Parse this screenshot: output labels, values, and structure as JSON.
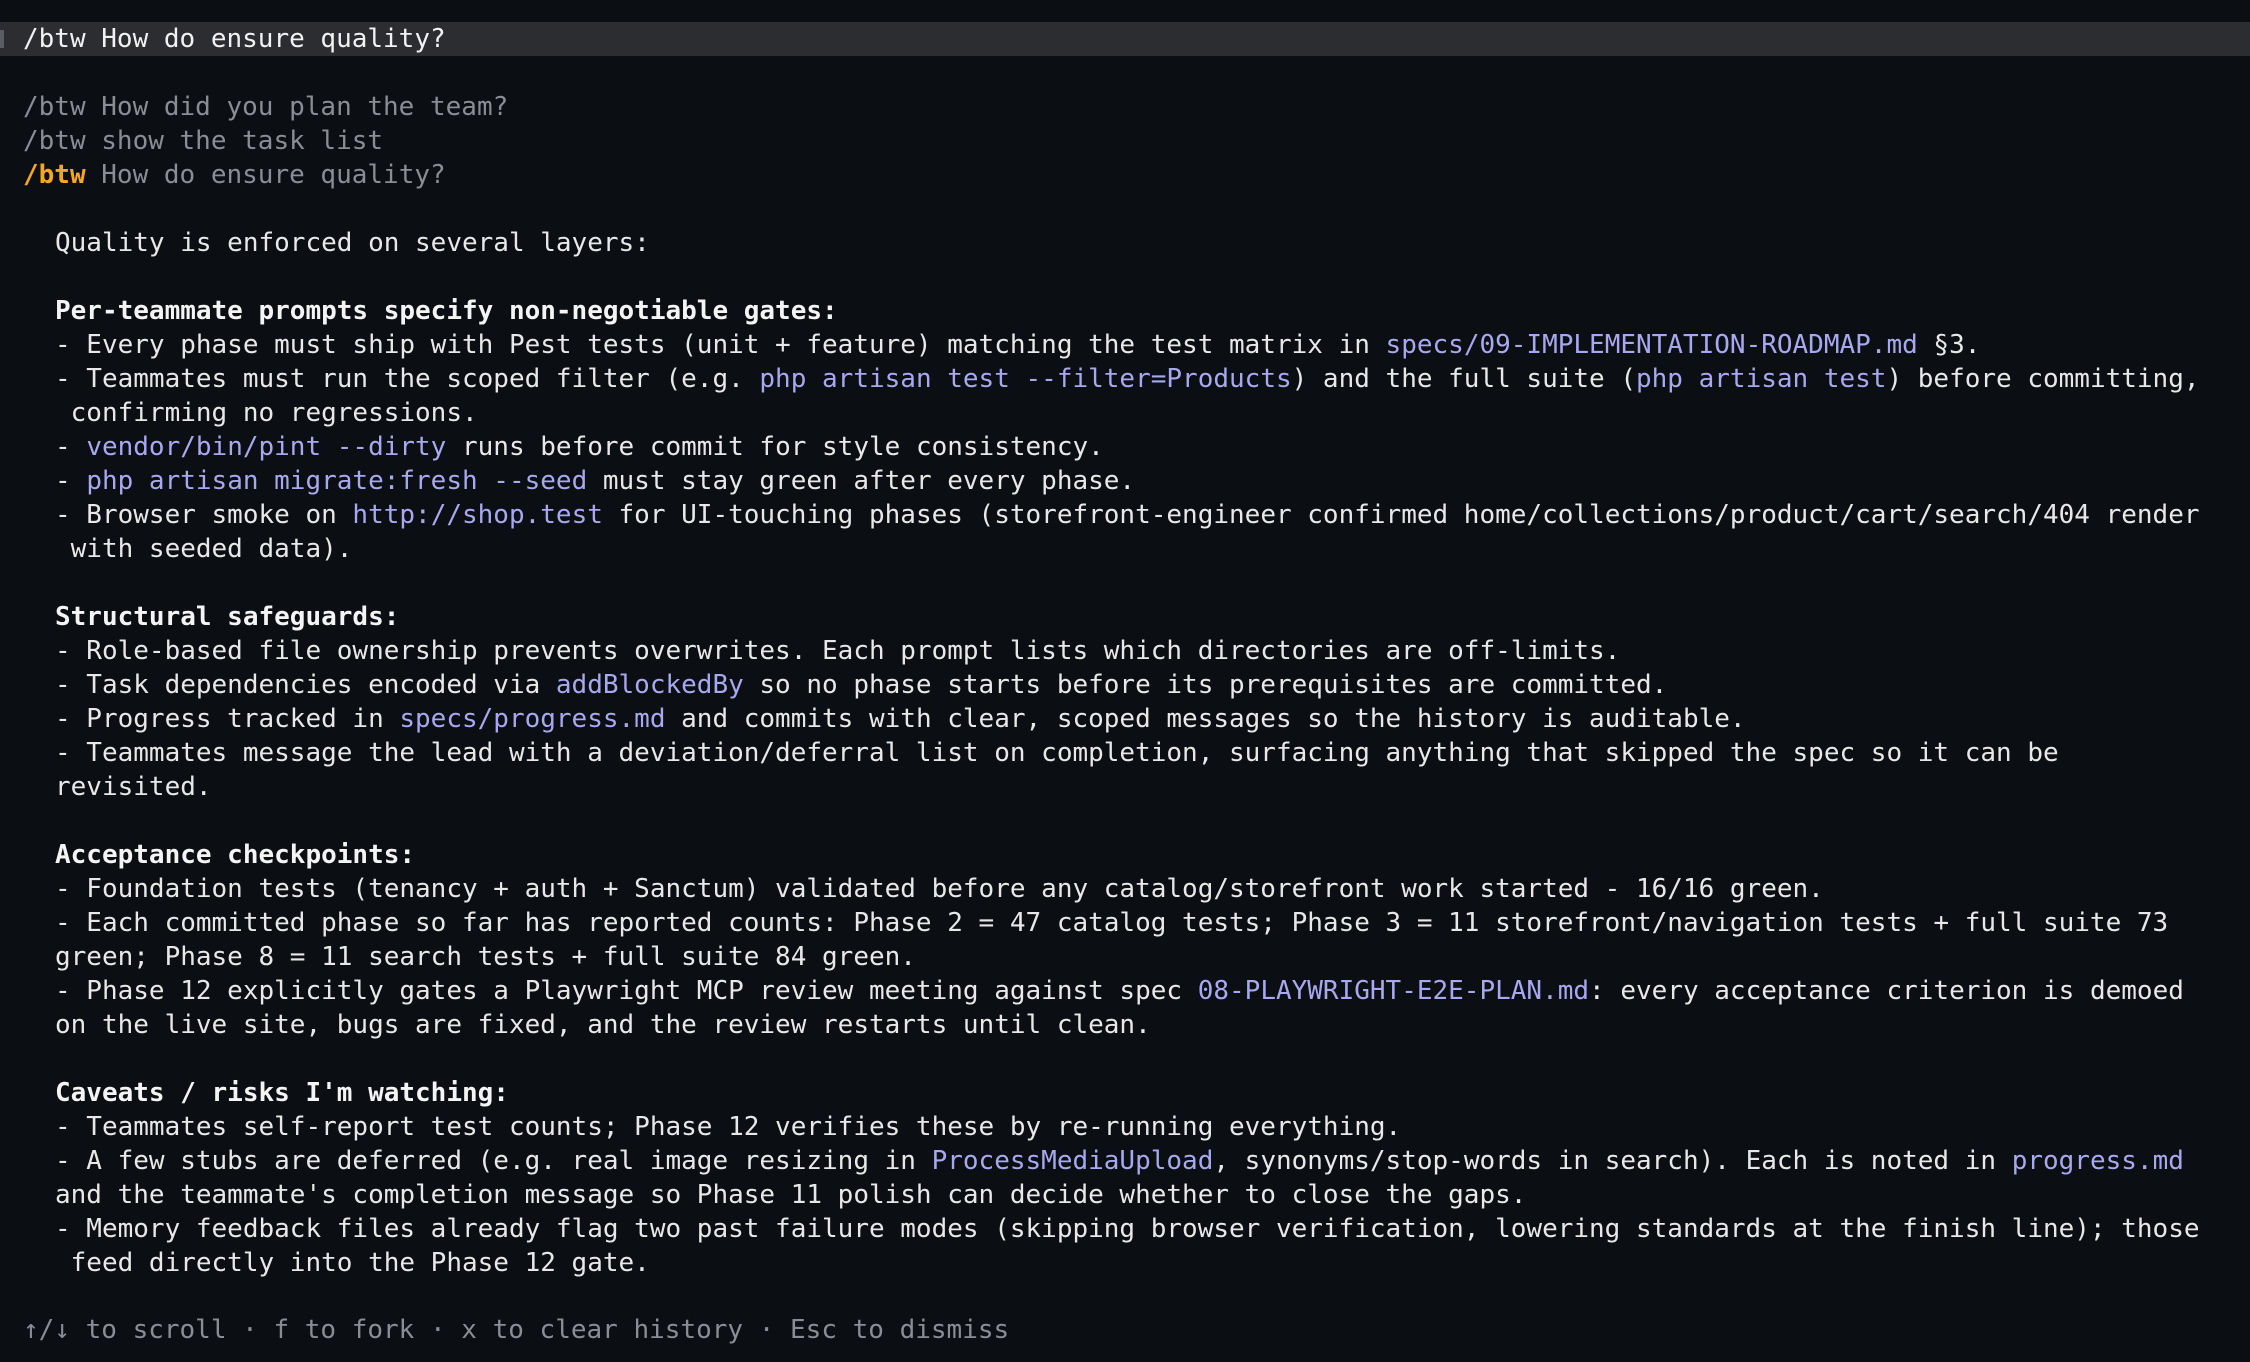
{
  "prompt": {
    "input_value": "/btw How do ensure quality?"
  },
  "history": [
    "/btw How did you plan the team?",
    "/btw show the task list"
  ],
  "active_history": {
    "command": "/btw",
    "text": " How do ensure quality?"
  },
  "response": {
    "intro": "Quality is enforced on several layers:",
    "s1_heading": "Per-teammate prompts specify non-negotiable gates:",
    "s1_l1_a": "- Every phase must ship with Pest tests (unit + feature) matching the test matrix in ",
    "s1_l1_code": "specs/09-IMPLEMENTATION-ROADMAP.md",
    "s1_l1_b": " §3.",
    "s1_l2_a": "- Teammates must run the scoped filter (e.g. ",
    "s1_l2_code1": "php artisan test --filter=Products",
    "s1_l2_b": ") and the full suite (",
    "s1_l2_code2": "php artisan test",
    "s1_l2_c": ") before committing,",
    "s1_l2_wrap": " confirming no regressions.",
    "s1_l3_a": "- ",
    "s1_l3_code": "vendor/bin/pint --dirty",
    "s1_l3_b": " runs before commit for style consistency.",
    "s1_l4_a": "- ",
    "s1_l4_code": "php artisan migrate:fresh --seed",
    "s1_l4_b": " must stay green after every phase.",
    "s1_l5_a": "- Browser smoke on ",
    "s1_l5_code": "http://shop.test",
    "s1_l5_b": " for UI-touching phases (storefront-engineer confirmed home/collections/product/cart/search/404 render",
    "s1_l5_wrap": " with seeded data).",
    "s2_heading": "Structural safeguards:",
    "s2_l1": "- Role-based file ownership prevents overwrites. Each prompt lists which directories are off-limits.",
    "s2_l2_a": "- Task dependencies encoded via ",
    "s2_l2_code": "addBlockedBy",
    "s2_l2_b": " so no phase starts before its prerequisites are committed.",
    "s2_l3_a": "- Progress tracked in ",
    "s2_l3_code": "specs/progress.md",
    "s2_l3_b": " and commits with clear, scoped messages so the history is auditable.",
    "s2_l4": "- Teammates message the lead with a deviation/deferral list on completion, surfacing anything that skipped the spec so it can be",
    "s2_l4_wrap": "revisited.",
    "s3_heading": "Acceptance checkpoints:",
    "s3_l1": "- Foundation tests (tenancy + auth + Sanctum) validated before any catalog/storefront work started - 16/16 green.",
    "s3_l2": "- Each committed phase so far has reported counts: Phase 2 = 47 catalog tests; Phase 3 = 11 storefront/navigation tests + full suite 73",
    "s3_l2_wrap": "green; Phase 8 = 11 search tests + full suite 84 green.",
    "s3_l3_a": "- Phase 12 explicitly gates a Playwright MCP review meeting against spec ",
    "s3_l3_code": "08-PLAYWRIGHT-E2E-PLAN.md",
    "s3_l3_b": ": every acceptance criterion is demoed",
    "s3_l3_wrap": "on the live site, bugs are fixed, and the review restarts until clean.",
    "s4_heading": "Caveats / risks I'm watching:",
    "s4_l1": "- Teammates self-report test counts; Phase 12 verifies these by re-running everything.",
    "s4_l2_a": "- A few stubs are deferred (e.g. real image resizing in ",
    "s4_l2_code1": "ProcessMediaUpload",
    "s4_l2_b": ", synonyms/stop-words in search). Each is noted in ",
    "s4_l2_code2": "progress.md",
    "s4_l2_wrap": "and the teammate's completion message so Phase 11 polish can decide whether to close the gaps.",
    "s4_l3": "- Memory feedback files already flag two past failure modes (skipping browser verification, lowering standards at the finish line); those",
    "s4_l3_wrap": " feed directly into the Phase 12 gate."
  },
  "footer": {
    "hint": "↑/↓ to scroll · f to fork · x to clear history · Esc to dismiss"
  }
}
